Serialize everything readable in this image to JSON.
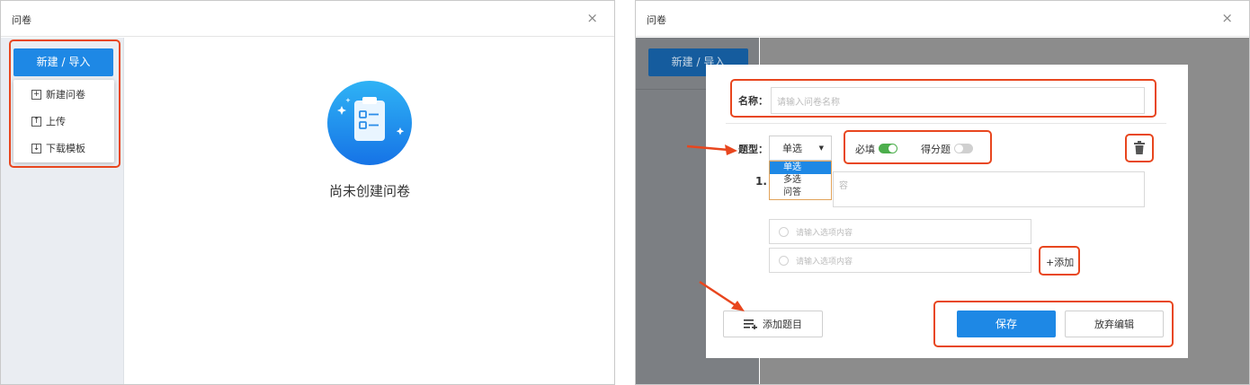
{
  "left": {
    "window_title": "问卷",
    "close_glyph": "×",
    "new_import_button": "新建 / 导入",
    "menu": [
      {
        "label": "新建问卷",
        "icon": "plus-box-icon",
        "glyph": "+"
      },
      {
        "label": "上传",
        "icon": "upload-box-icon",
        "glyph": "↑"
      },
      {
        "label": "下载模板",
        "icon": "download-box-icon",
        "glyph": "↓"
      }
    ],
    "empty_state_text": "尚未创建问卷"
  },
  "right": {
    "window_title": "问卷",
    "close_glyph": "×",
    "new_import_button": "新建 / 导入",
    "name_label": "名称：",
    "name_placeholder": "请输入问卷名称",
    "type_label": "题型：",
    "type_selected": "单选",
    "type_options": [
      "单选",
      "多选",
      "问答"
    ],
    "required_label": "必填",
    "scored_label": "得分题",
    "question_number": "1.",
    "question_placeholder_tail": "容",
    "option_placeholder": "请输入选项内容",
    "add_option": "+添加",
    "add_question": "添加题目",
    "save_button": "保存",
    "discard_button": "放弃编辑"
  },
  "colors": {
    "primary": "#1e88e5",
    "highlight_red": "#e8461e",
    "toggle_on": "#4cae4c",
    "toggle_off": "#d0d0d0",
    "sidebar_bg": "#eaedf2",
    "overlay": "#8c8c8c"
  },
  "toggles": {
    "required_on": true,
    "scored_on": false
  }
}
